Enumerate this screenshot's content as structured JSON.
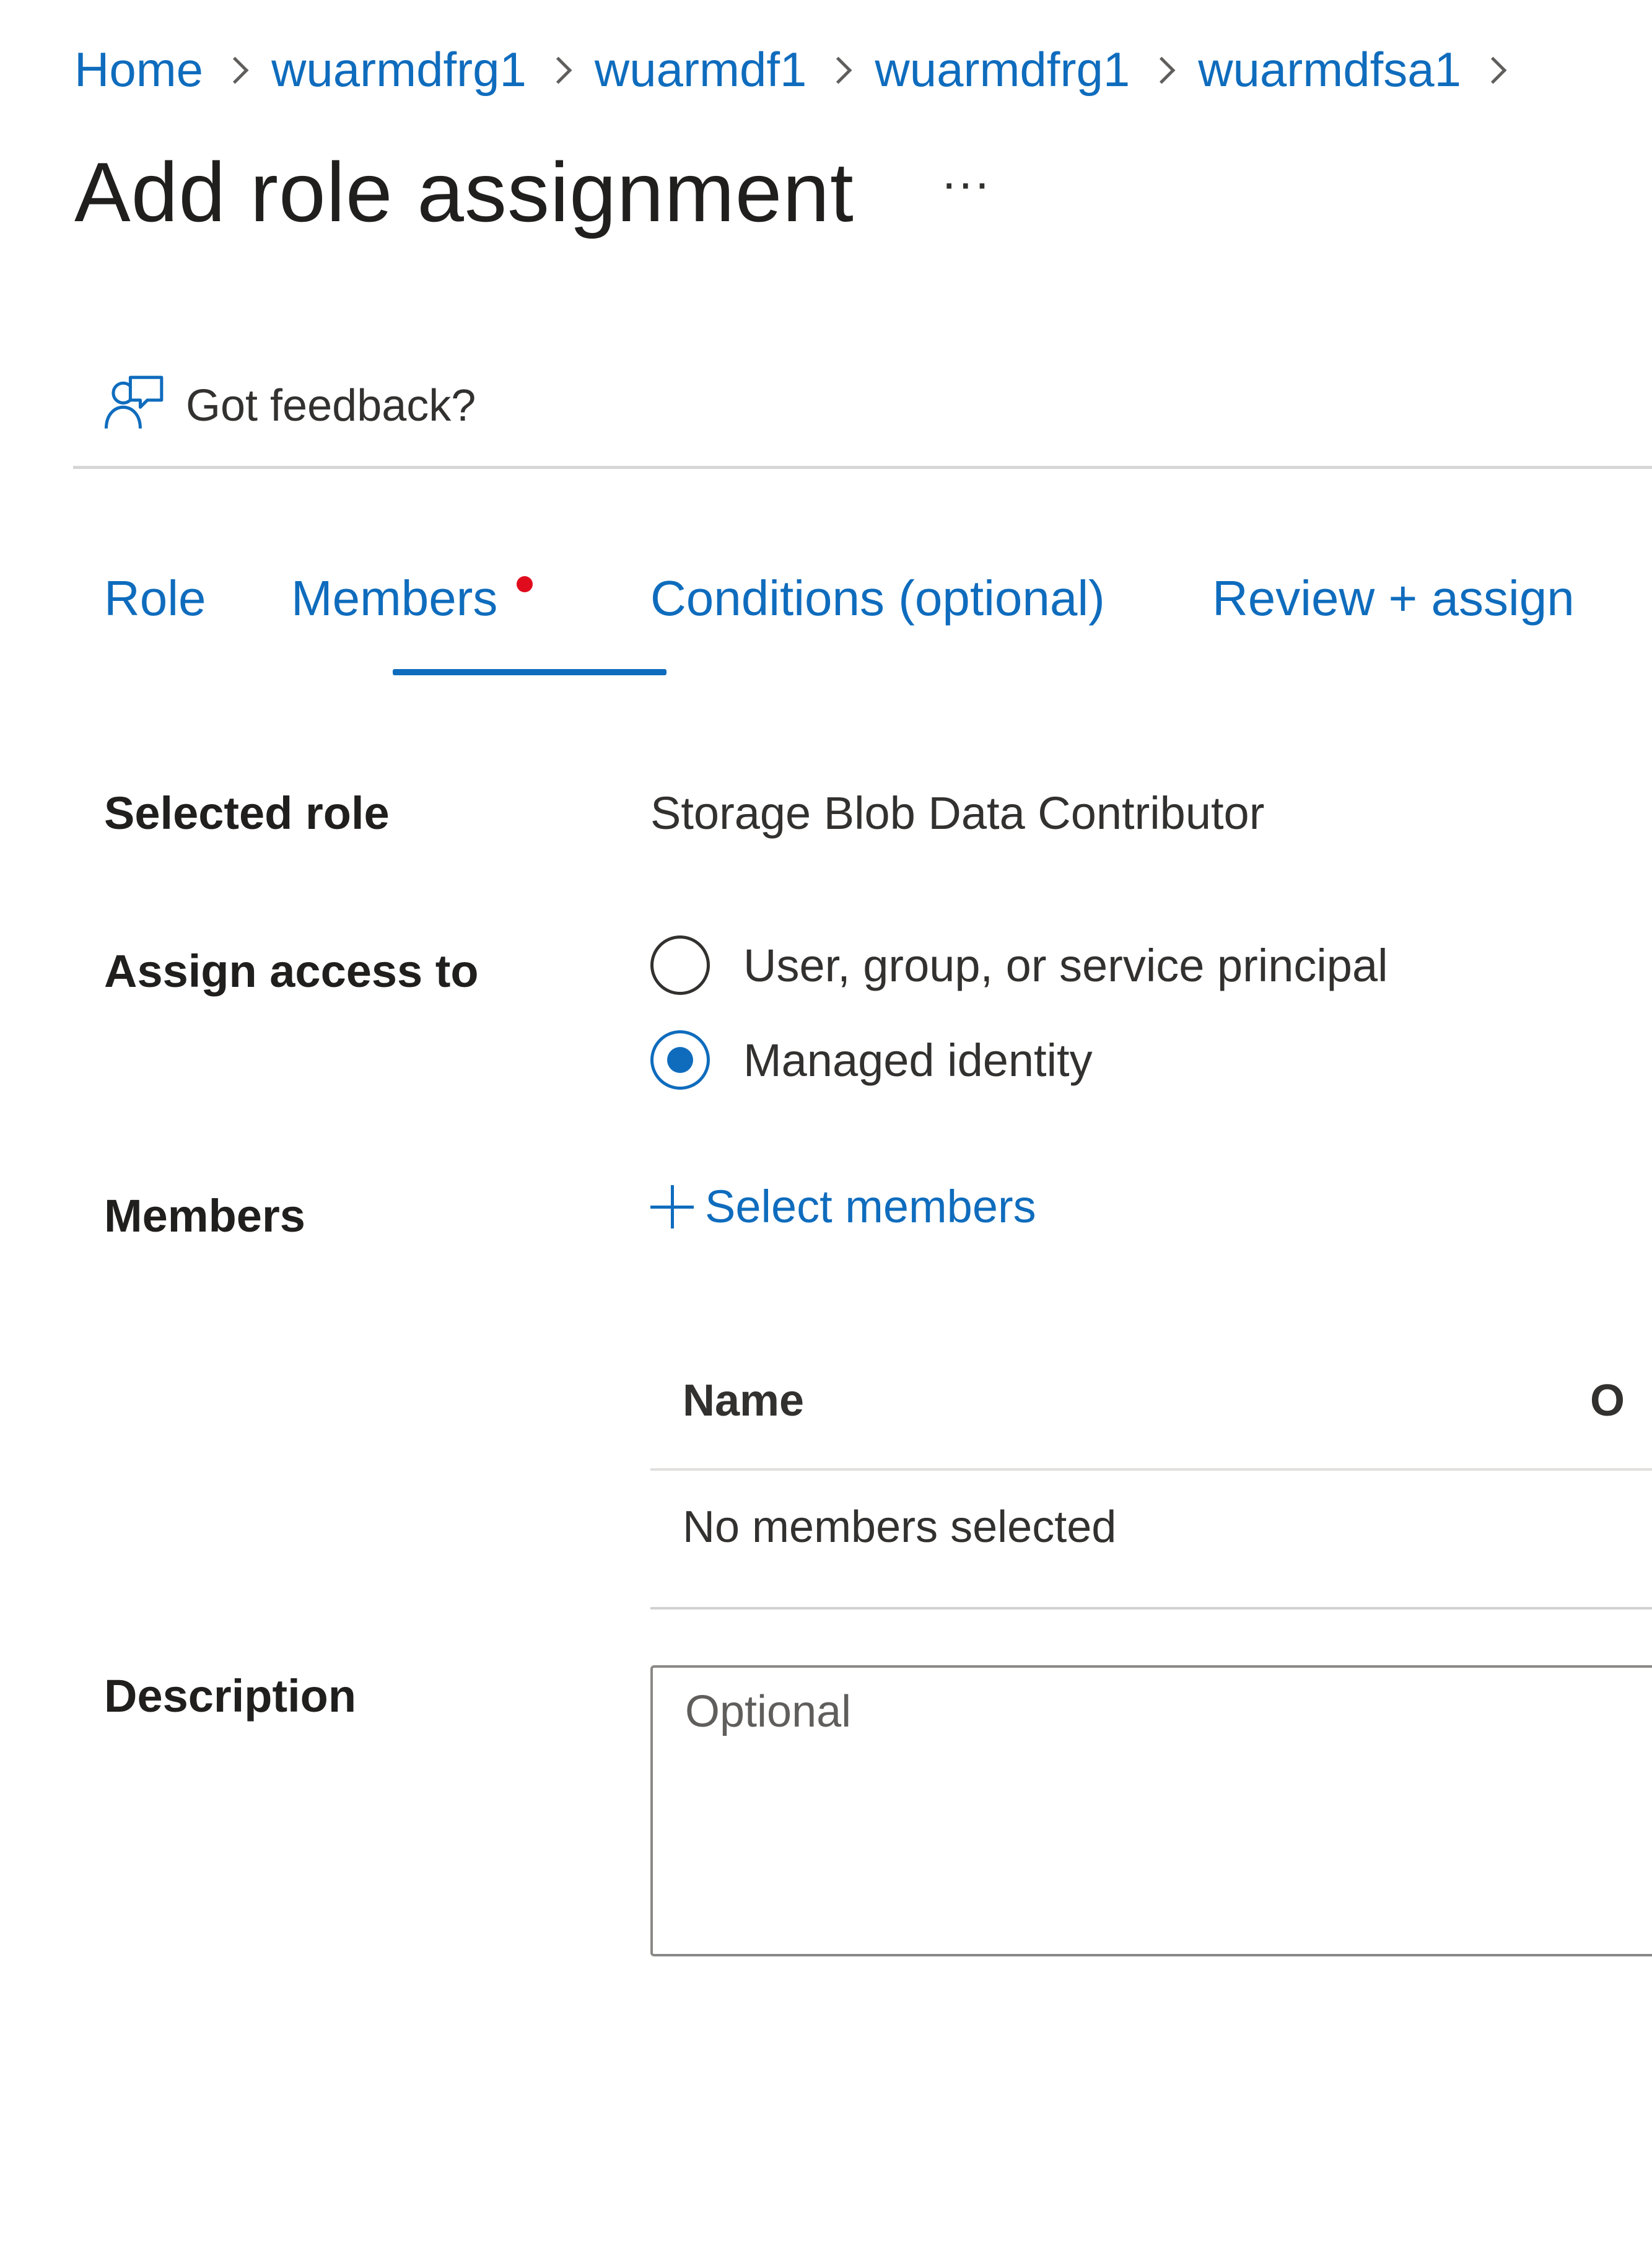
{
  "breadcrumb": {
    "items": [
      {
        "label": "Home"
      },
      {
        "label": "wuarmdfrg1"
      },
      {
        "label": "wuarmdf1"
      },
      {
        "label": "wuarmdfrg1"
      },
      {
        "label": "wuarmdfsa1"
      }
    ]
  },
  "header": {
    "title": "Add role assignment",
    "more": "···"
  },
  "feedback": {
    "label": "Got feedback?",
    "icon": "feedback-icon"
  },
  "tabs": [
    {
      "label": "Role"
    },
    {
      "label": "Members",
      "active": true,
      "has_dot": true
    },
    {
      "label": "Conditions (optional)"
    },
    {
      "label": "Review + assign"
    }
  ],
  "form": {
    "selected_role": {
      "label": "Selected role",
      "value": "Storage Blob Data Contributor"
    },
    "assign_access": {
      "label": "Assign access to",
      "options": [
        {
          "label": "User, group, or service principal",
          "checked": false
        },
        {
          "label": "Managed identity",
          "checked": true
        }
      ]
    },
    "members": {
      "label": "Members",
      "select_label": "Select members",
      "table": {
        "columns": [
          "Name",
          "O"
        ],
        "empty_text": "No members selected"
      }
    },
    "description": {
      "label": "Description",
      "placeholder": "Optional"
    }
  },
  "colors": {
    "accent": "#0f6cbd",
    "badge": "#e00b1c",
    "text": "#323130"
  }
}
